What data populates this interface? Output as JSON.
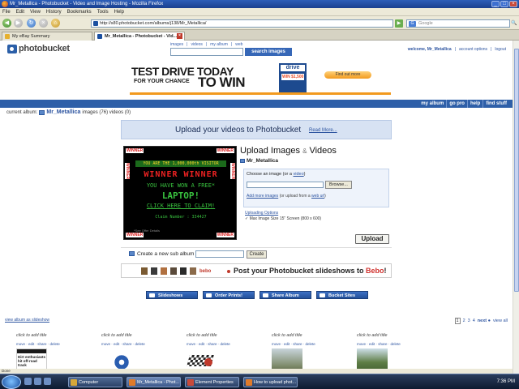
{
  "window": {
    "title": "Mr_Metallica - Photobucket - Video and Image Hosting - Mozilla Firefox"
  },
  "menu": [
    "File",
    "Edit",
    "View",
    "History",
    "Bookmarks",
    "Tools",
    "Help"
  ],
  "nav": {
    "url": "http://s80.photobucket.com/albums/j138/Mr_Metallica/",
    "search_placeholder": "Google",
    "back": "◀",
    "forward": "▶",
    "go": "▶",
    "search_btn": "🔍"
  },
  "tabs": [
    {
      "label": "My eBay Summary"
    },
    {
      "label": "Mr_Metallica - Photobucket - Vid..."
    }
  ],
  "pb": {
    "logo": "photobucket",
    "top_links": [
      "images",
      "videos",
      "my album",
      "web"
    ],
    "search_button": "search images",
    "welcome": "welcome, Mr_Metallica",
    "account": "account options",
    "logout": "logout"
  },
  "ad": {
    "line1": "TEST DRIVE TODAY",
    "line2": "FOR YOUR CHANCE",
    "line3": "TO WIN",
    "drive": "drive",
    "drive_win": "WIN $1,500",
    "find": "Find out more"
  },
  "bluebar": [
    "my album",
    "go pro",
    "help",
    "find stuff"
  ],
  "current": {
    "label": "current album:",
    "name": "Mr_Metallica",
    "counts": "images (76) videos (0)"
  },
  "upload_video": {
    "text": "Upload your videos to Photobucket",
    "read_more": "Read More..."
  },
  "winner": {
    "corner": "WINNER",
    "visitor": "YOU ARE THE 1,000,000th VISITOR",
    "ww": "WINNER WINNER",
    "have_won": "YOU HAVE WON A FREE*",
    "laptop": "LAPTOP!",
    "click": "CLICK HERE TO CLAIM!",
    "claim": "Claim Number : 334427",
    "details": "*See Offer Details"
  },
  "upload": {
    "title": "Upload Images",
    "amp": "&",
    "title2": "Videos",
    "album": "Mr_Metallica",
    "choose": "Choose an image",
    "choose_or": "(or a",
    "choose_video": "video",
    "choose_close": ")",
    "browse": "Browse...",
    "more_images": "Add more images",
    "more_sep": "(or upload from a",
    "web_url": "web url",
    "more_close": ")",
    "options_title": "Uploading Options",
    "options_sub": "✓ Max Image Size 15\" Screen (800 x 600)",
    "button": "Upload"
  },
  "subalbum": {
    "label": "Create a new sub album",
    "button": "Create"
  },
  "bebo": {
    "logo": "bebo",
    "post": "Post your Photobucket slideshows to",
    "bebo_word": "Bebo",
    "bang": "!"
  },
  "actions": [
    "Slideshows",
    "Order Prints!",
    "Share Album",
    "Bucket Sites"
  ],
  "view_slideshow": "view album as slideshow",
  "pager": [
    "1",
    "2",
    "3",
    "4",
    "next",
    "view all"
  ],
  "thumbs": [
    {
      "title": "click to add title",
      "links": "move · edit · share · delete"
    },
    {
      "title": "click to add title",
      "links": "move · edit · share · delete"
    },
    {
      "title": "click to add title",
      "links": "move · edit · share · delete"
    },
    {
      "title": "click to add title",
      "links": "move · edit · share · delete"
    },
    {
      "title": "click to add title",
      "links": "move · edit · share · delete"
    }
  ],
  "thumb0_text": "Dirt enthusiasts hit off-road track",
  "status": "Done",
  "taskbar": {
    "items": [
      "Computer",
      "Mr_Metallica - Phot...",
      "Element Properties",
      "How to upload phot..."
    ],
    "clock": "7:36 PM"
  }
}
